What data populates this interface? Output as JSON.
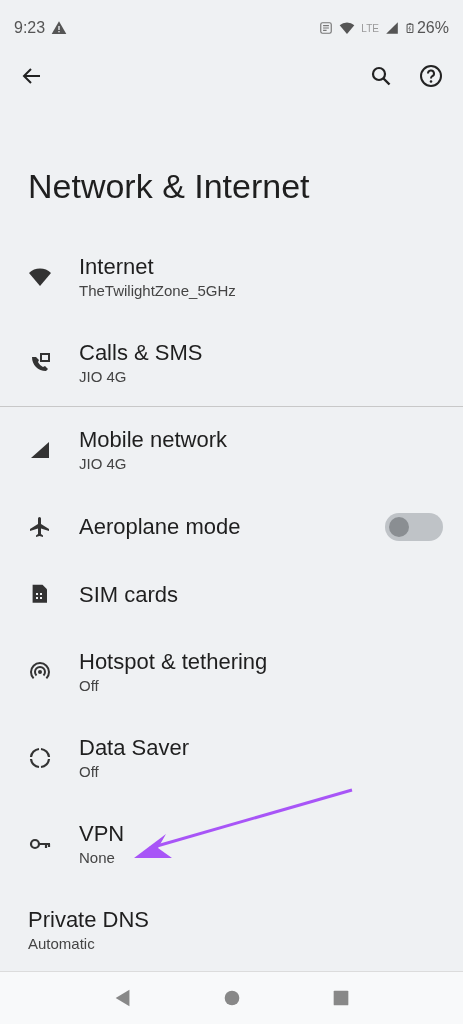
{
  "status_bar": {
    "time": "9:23",
    "battery": "26%",
    "network_label": "LTE"
  },
  "page": {
    "title": "Network & Internet"
  },
  "groups": [
    {
      "items": [
        {
          "kind": "link",
          "title": "Internet",
          "subtitle": "TheTwilightZone_5GHz"
        },
        {
          "kind": "link",
          "title": "Calls & SMS",
          "subtitle": "JIO 4G"
        }
      ]
    },
    {
      "items": [
        {
          "kind": "link",
          "title": "Mobile network",
          "subtitle": "JIO 4G"
        },
        {
          "kind": "toggle",
          "title": "Aeroplane mode",
          "on": false
        },
        {
          "kind": "link",
          "title": "SIM cards"
        },
        {
          "kind": "link",
          "title": "Hotspot & tethering",
          "subtitle": "Off"
        },
        {
          "kind": "link",
          "title": "Data Saver",
          "subtitle": "Off"
        },
        {
          "kind": "link",
          "title": "VPN",
          "subtitle": "None"
        },
        {
          "kind": "plain",
          "title": "Private DNS",
          "subtitle": "Automatic"
        }
      ]
    }
  ]
}
